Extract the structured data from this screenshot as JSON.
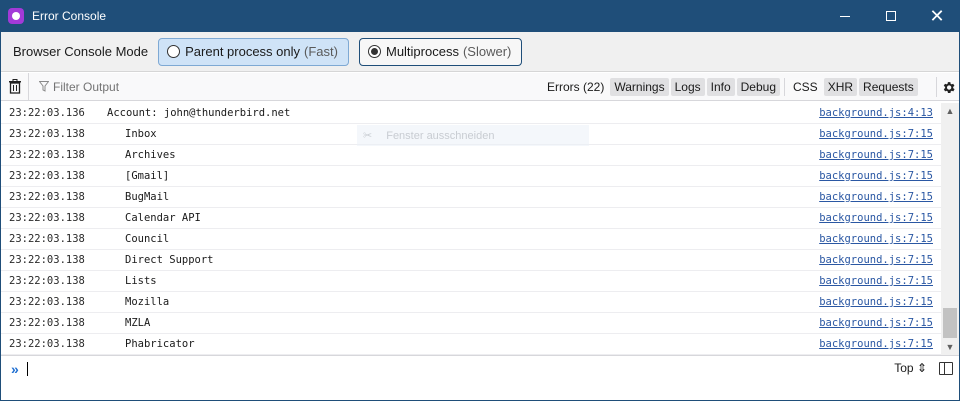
{
  "window": {
    "title": "Error Console",
    "controls": {
      "minimize": "",
      "maximize": "",
      "close": "✕"
    }
  },
  "mode_bar": {
    "label": "Browser Console Mode",
    "options": [
      {
        "label": "Parent process only",
        "hint": "(Fast)",
        "selected": false
      },
      {
        "label": "Multiprocess",
        "hint": "(Slower)",
        "selected": true
      }
    ]
  },
  "toolbar": {
    "filter_placeholder": "Filter Output",
    "filters": [
      "Errors (22)",
      "Warnings",
      "Logs",
      "Info",
      "Debug"
    ],
    "filters2": [
      "CSS",
      "XHR",
      "Requests"
    ]
  },
  "log": {
    "rows": [
      {
        "time": "23:22:03.136",
        "message": "Account: john@thunderbird.net",
        "source": "background.js:4:13",
        "indent": false
      },
      {
        "time": "23:22:03.138",
        "message": "Inbox",
        "source": "background.js:7:15",
        "indent": true
      },
      {
        "time": "23:22:03.138",
        "message": "Archives",
        "source": "background.js:7:15",
        "indent": true
      },
      {
        "time": "23:22:03.138",
        "message": "[Gmail]",
        "source": "background.js:7:15",
        "indent": true
      },
      {
        "time": "23:22:03.138",
        "message": "BugMail",
        "source": "background.js:7:15",
        "indent": true
      },
      {
        "time": "23:22:03.138",
        "message": "Calendar API",
        "source": "background.js:7:15",
        "indent": true
      },
      {
        "time": "23:22:03.138",
        "message": "Council",
        "source": "background.js:7:15",
        "indent": true
      },
      {
        "time": "23:22:03.138",
        "message": "Direct Support",
        "source": "background.js:7:15",
        "indent": true
      },
      {
        "time": "23:22:03.138",
        "message": "Lists",
        "source": "background.js:7:15",
        "indent": true
      },
      {
        "time": "23:22:03.138",
        "message": "Mozilla",
        "source": "background.js:7:15",
        "indent": true
      },
      {
        "time": "23:22:03.138",
        "message": "MZLA",
        "source": "background.js:7:15",
        "indent": true
      },
      {
        "time": "23:22:03.138",
        "message": "Phabricator",
        "source": "background.js:7:15",
        "indent": true
      }
    ],
    "ghost_menu": {
      "icon": "✂",
      "label": "Fenster ausschneiden"
    }
  },
  "input": {
    "prompt": "»",
    "context": "Top ⇕"
  },
  "colors": {
    "titlebar": "#1f4e79",
    "accent": "#1f6fd1",
    "link": "#2a57a3",
    "selected_mode": "#cfe3f7"
  }
}
